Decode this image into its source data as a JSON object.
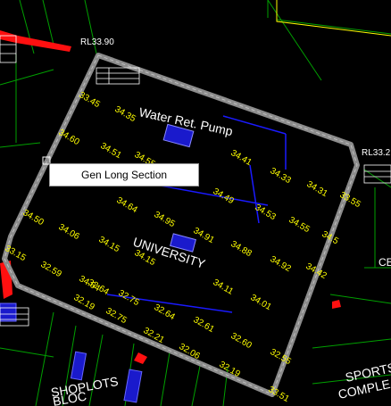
{
  "context_menu": {
    "items": [
      {
        "label": "Gen Long Section"
      }
    ]
  },
  "labels": {
    "rl_top": "RL33.90",
    "rl_right": "RL33.2",
    "water_ret_pump": "Water Ret. Pump",
    "university": "UNIVERSITY",
    "sports": "SPORTS",
    "complex": "COMPLE",
    "shoplots": "SHOPLOTS",
    "block": "BLOC",
    "ce": "CE"
  },
  "spot_levels": [
    "33.45",
    "34.35",
    "34.60",
    "34.51",
    "34.55",
    "34.41",
    "34.33",
    "34.31",
    "34.49",
    "34.53",
    "34.64",
    "34.95",
    "34.91",
    "34.88",
    "34.55",
    "34.5",
    "34.06",
    "34.15",
    "34.15",
    "34.11",
    "34.92",
    "32.59",
    "34.64",
    "32.64",
    "32.75",
    "32.64",
    "32.61",
    "32.60",
    "32.55",
    "32.19",
    "32.75",
    "32.21",
    "32.06",
    "32.19",
    "33.15",
    "33.55",
    "33.51",
    "34.50",
    "34.01",
    "34.42"
  ],
  "colors": {
    "background": "#000000",
    "boundary": "#8c8c8c",
    "level_text": "#ffff00",
    "grid_line": "#00cc00",
    "road": "#ff0000",
    "pipe": "#0000ff"
  }
}
